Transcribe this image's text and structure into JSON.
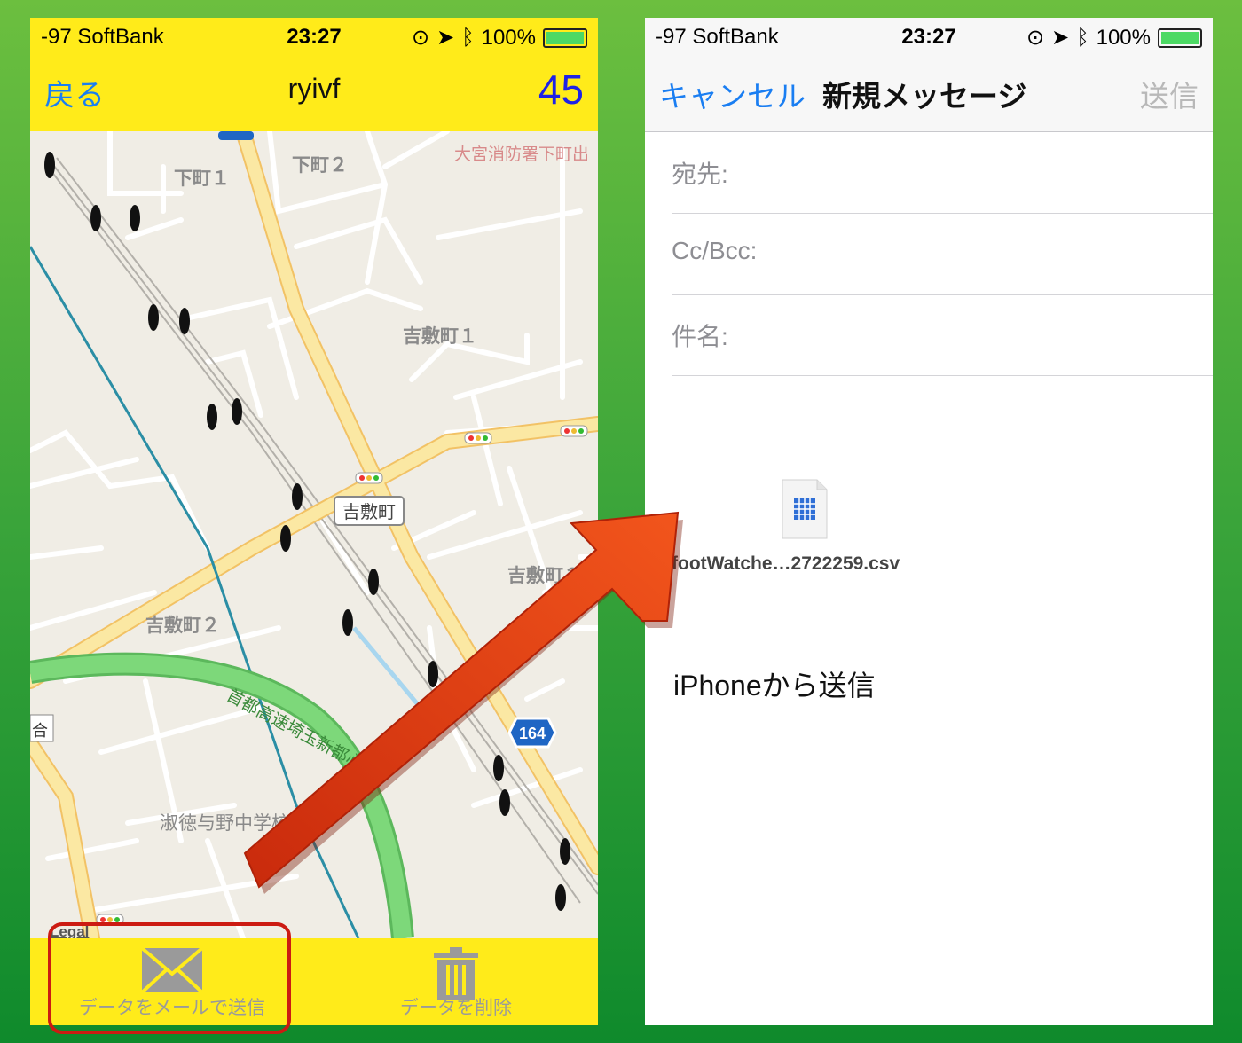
{
  "left_screen": {
    "status": {
      "carrier": "-97 SoftBank",
      "time": "23:27",
      "battery": "100%"
    },
    "nav": {
      "back": "戻る",
      "title": "ryivf",
      "count": "45"
    },
    "map_labels": {
      "shimocho1": "下町１",
      "shimocho2": "下町２",
      "fire_station": "大宮消防署下町出",
      "yoshikicho1": "吉敷町１",
      "yoshikicho_badge": "吉敷町",
      "yoshikicho2_right": "吉敷町２",
      "yoshikicho2_left": "吉敷町２",
      "expressway": "首都高速埼玉新都心",
      "route": "164",
      "school": "淑徳与野中学校",
      "legal": "Legal",
      "edge_kanji": "合"
    },
    "toolbar": {
      "mail_label": "データをメールで送信",
      "delete_label": "データを削除"
    }
  },
  "right_screen": {
    "status": {
      "carrier": "-97 SoftBank",
      "time": "23:27",
      "battery": "100%"
    },
    "nav": {
      "cancel": "キャンセル",
      "title": "新規メッセージ",
      "send": "送信"
    },
    "fields": {
      "to": "宛先:",
      "ccbcc": "Cc/Bcc:",
      "subject": "件名:"
    },
    "attachment": {
      "filename": "footWatche…2722259.csv"
    },
    "signature": "iPhoneから送信"
  },
  "colors": {
    "nav_yellow": "#ffeb1a",
    "ios_blue": "#1a7ef2",
    "arrow_red": "#e0330f",
    "highlight_red": "#cc1b12"
  }
}
